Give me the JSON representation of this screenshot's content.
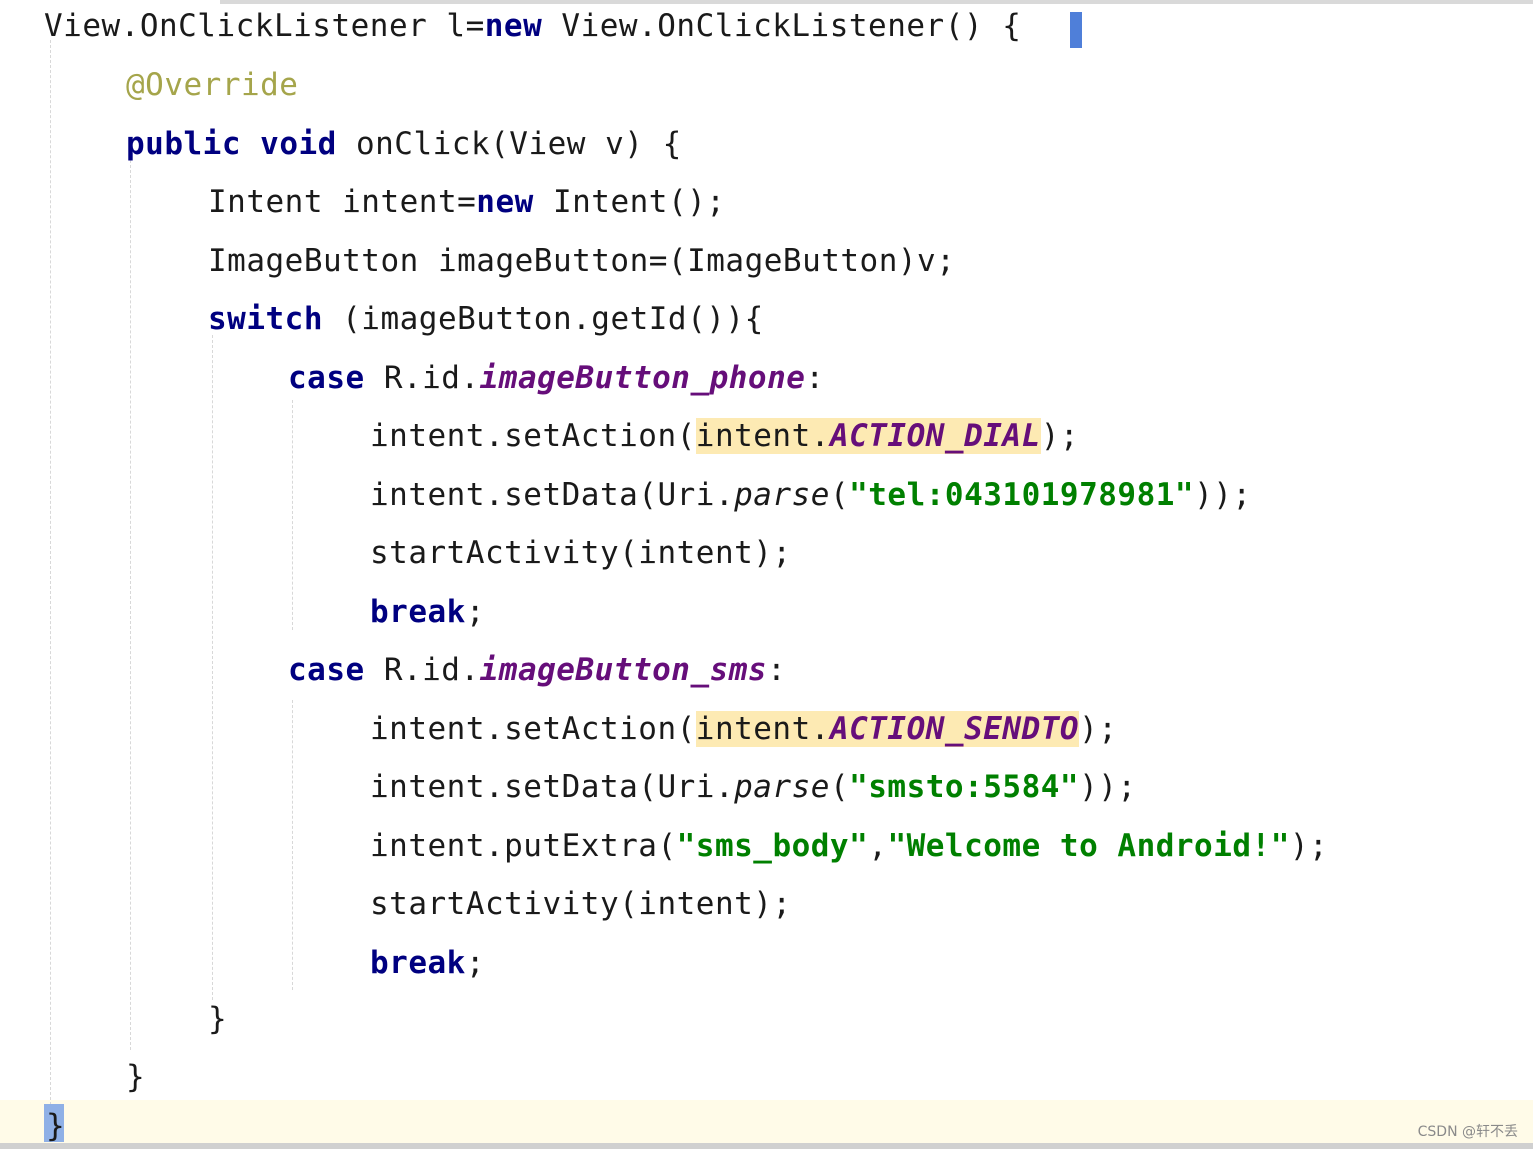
{
  "code": {
    "line1": {
      "p1": "View.OnClickListener l=",
      "kw": "new",
      "p2": " View.OnClickListener() {"
    },
    "line2": {
      "ann": "@Override"
    },
    "line3": {
      "kw1": "public",
      "kw2": "void",
      "p1": " onClick(View v) {"
    },
    "line4": {
      "p1": "Intent intent=",
      "kw": "new",
      "p2": " Intent();"
    },
    "line5": {
      "p1": "ImageButton imageButton=(ImageButton)v;"
    },
    "line6": {
      "kw": "switch",
      "p1": " (imageButton.getId()){"
    },
    "line7": {
      "kw": "case",
      "p1": " R.id.",
      "field": "imageButton_phone",
      "p2": ":"
    },
    "line8": {
      "p1": "intent.setAction(",
      "hl1": "intent.",
      "field": "ACTION_DIAL",
      "p2": ");"
    },
    "line9": {
      "p1": "intent.setData(Uri.",
      "method": "parse",
      "p2": "(",
      "str": "\"tel:043101978981\"",
      "p3": "));"
    },
    "line10": {
      "p1": "startActivity(intent);"
    },
    "line11": {
      "kw": "break",
      "p1": ";"
    },
    "line12": {
      "kw": "case",
      "p1": " R.id.",
      "field": "imageButton_sms",
      "p2": ":"
    },
    "line13": {
      "p1": "intent.setAction(",
      "hl1": "intent.",
      "field": "ACTION_SENDTO",
      "p2": ");"
    },
    "line14": {
      "p1": "intent.setData(Uri.",
      "method": "parse",
      "p2": "(",
      "str": "\"smsto:5584\"",
      "p3": "));"
    },
    "line15": {
      "p1": "intent.putExtra(",
      "str1": "\"sms_body\"",
      "p2": ",",
      "str2": "\"Welcome to Android!\"",
      "p3": ");"
    },
    "line16": {
      "p1": "startActivity(intent);"
    },
    "line17": {
      "kw": "break",
      "p1": ";"
    },
    "line18": {
      "p1": "}"
    },
    "line19": {
      "p1": "}"
    },
    "line20": {
      "p1": "}"
    }
  },
  "watermark": "CSDN @轩不丢",
  "colors": {
    "keyword": "#000080",
    "annotation": "#808000",
    "field": "#660e7a",
    "string": "#008000",
    "highlight": "#fdeab3",
    "caret_line": "#fffbe8"
  }
}
